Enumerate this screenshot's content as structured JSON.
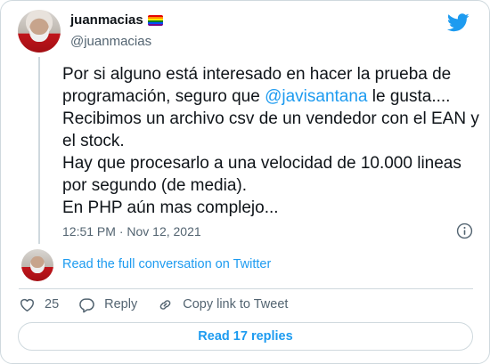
{
  "user": {
    "name": "juanmacias",
    "handle": "@juanmacias"
  },
  "tweet": {
    "text_before": "Por si alguno está interesado en hacer la prueba de programación, seguro que ",
    "mention": "@javisantana",
    "text_after": " le gusta.... Recibimos un archivo csv de un vendedor con el EAN y el stock.",
    "line2": "Hay que procesarlo a una velocidad de 10.000 lineas por segundo (de media).",
    "line3": "En PHP aún mas complejo...",
    "timestamp": "12:51 PM · Nov 12, 2021"
  },
  "conversation": {
    "link_label": "Read the full conversation on Twitter"
  },
  "actions": {
    "like_count": "25",
    "reply_label": "Reply",
    "copy_label": "Copy link to Tweet"
  },
  "replies": {
    "label": "Read 17 replies"
  },
  "colors": {
    "accent": "#1d9bf0",
    "text": "#0f1419",
    "secondary": "#536471",
    "border": "#cfd9de"
  },
  "icons": {
    "brand": "twitter-bird-icon",
    "info": "info-icon",
    "like": "heart-icon",
    "reply": "speech-bubble-icon",
    "copy": "link-icon",
    "badge": "rainbow-flag-icon"
  }
}
